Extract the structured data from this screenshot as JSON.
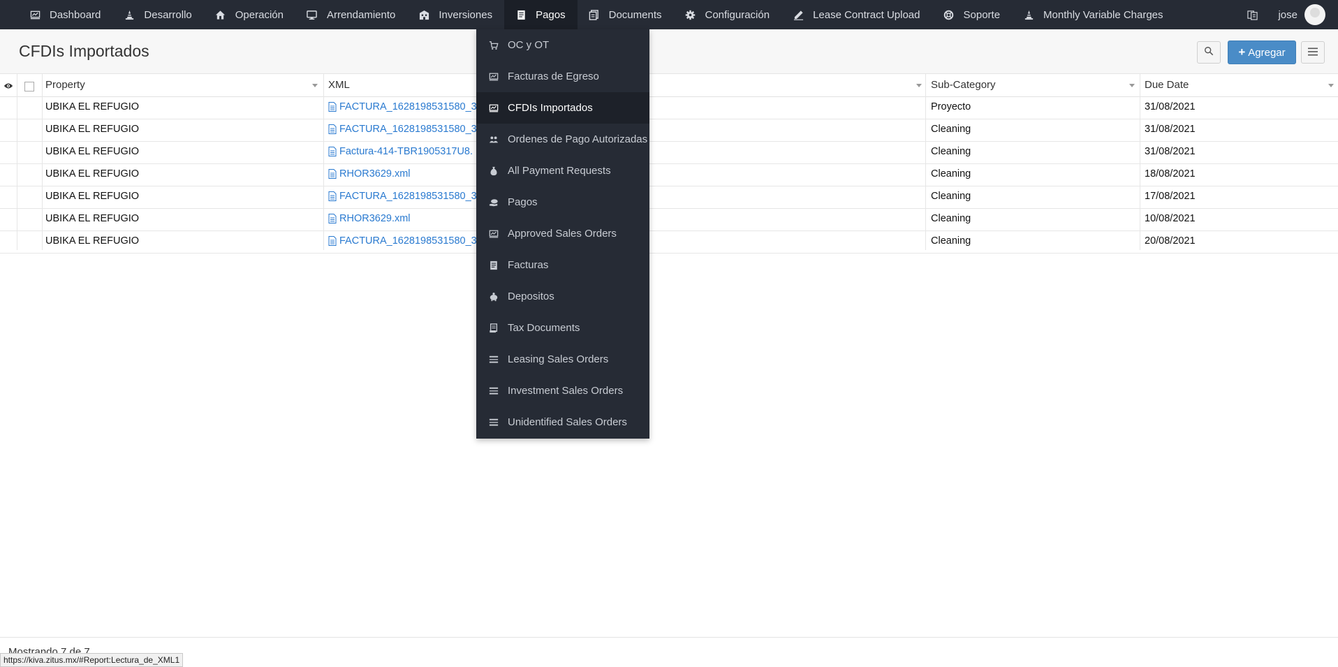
{
  "nav": {
    "items": [
      {
        "label": "Dashboard",
        "icon": "chart-icon"
      },
      {
        "label": "Desarrollo",
        "icon": "cone-icon"
      },
      {
        "label": "Operación",
        "icon": "home-icon"
      },
      {
        "label": "Arrendamiento",
        "icon": "monitor-icon"
      },
      {
        "label": "Inversiones",
        "icon": "building-icon"
      },
      {
        "label": "Pagos",
        "icon": "receipt-icon",
        "active": true
      },
      {
        "label": "Documents",
        "icon": "document-icon"
      },
      {
        "label": "Configuración",
        "icon": "gear-icon"
      },
      {
        "label": "Lease Contract Upload",
        "icon": "pen-icon"
      },
      {
        "label": "Soporte",
        "icon": "lifebuoy-icon"
      },
      {
        "label": "Monthly Variable Charges",
        "icon": "cone-icon"
      }
    ],
    "user": "jose"
  },
  "page": {
    "title": "CFDIs Importados",
    "add_label": "Agregar"
  },
  "table": {
    "columns": [
      "Property",
      "XML",
      "Sub-Category",
      "Due Date"
    ],
    "rows": [
      {
        "property": "UBIKA EL REFUGIO",
        "xml": "FACTURA_1628198531580_3",
        "subcategory": "Proyecto",
        "due": "31/08/2021"
      },
      {
        "property": "UBIKA EL REFUGIO",
        "xml": "FACTURA_1628198531580_3",
        "subcategory": "Cleaning",
        "due": "31/08/2021"
      },
      {
        "property": "UBIKA EL REFUGIO",
        "xml": "Factura-414-TBR1905317U8.",
        "subcategory": "Cleaning",
        "due": "31/08/2021"
      },
      {
        "property": "UBIKA EL REFUGIO",
        "xml": "RHOR3629.xml",
        "subcategory": "Cleaning",
        "due": "18/08/2021"
      },
      {
        "property": "UBIKA EL REFUGIO",
        "xml": "FACTURA_1628198531580_3",
        "subcategory": "Cleaning",
        "due": "17/08/2021"
      },
      {
        "property": "UBIKA EL REFUGIO",
        "xml": "RHOR3629.xml",
        "subcategory": "Cleaning",
        "due": "10/08/2021"
      },
      {
        "property": "UBIKA EL REFUGIO",
        "xml": "FACTURA_1628198531580_3",
        "subcategory": "Cleaning",
        "due": "20/08/2021"
      }
    ]
  },
  "dropdown": {
    "items": [
      {
        "label": "OC y OT",
        "icon": "cart-icon"
      },
      {
        "label": "Facturas de Egreso",
        "icon": "chart-icon"
      },
      {
        "label": "CFDIs Importados",
        "icon": "chart-icon",
        "active": true
      },
      {
        "label": "Ordenes de Pago Autorizadas",
        "icon": "people-icon"
      },
      {
        "label": "All Payment Requests",
        "icon": "money-bag-icon"
      },
      {
        "label": "Pagos",
        "icon": "money-hand-icon"
      },
      {
        "label": "Approved Sales Orders",
        "icon": "chart-icon"
      },
      {
        "label": "Facturas",
        "icon": "receipt-icon"
      },
      {
        "label": "Depositos",
        "icon": "piggy-bank-icon"
      },
      {
        "label": "Tax Documents",
        "icon": "scroll-icon"
      },
      {
        "label": "Leasing Sales Orders",
        "icon": "list-icon"
      },
      {
        "label": "Investment Sales Orders",
        "icon": "list-icon"
      },
      {
        "label": "Unidentified Sales Orders",
        "icon": "list-icon"
      }
    ]
  },
  "footer": {
    "count_text": "Mostrando 7 de 7",
    "status_url": "https://kiva.zitus.mx/#Report:Lectura_de_XML1"
  },
  "colors": {
    "navbar": "#262b35",
    "accent": "#4a8cc7",
    "link": "#2a7ad0"
  }
}
